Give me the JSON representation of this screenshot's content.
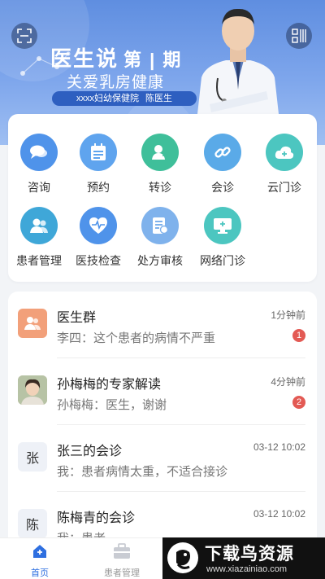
{
  "banner": {
    "title": "医生说",
    "issue": "第 | 期",
    "subtitle": "关爱乳房健康",
    "hospital": "xxxx妇幼保健院",
    "doctor": "陈医生"
  },
  "services": [
    {
      "label": "咨询",
      "icon": "chat-icon",
      "color": "#4f93ea"
    },
    {
      "label": "预约",
      "icon": "calendar-icon",
      "color": "#5fa4ee"
    },
    {
      "label": "转诊",
      "icon": "transfer-icon",
      "color": "#3fbf9a"
    },
    {
      "label": "会诊",
      "icon": "link-icon",
      "color": "#5aaae8"
    },
    {
      "label": "云门诊",
      "icon": "cloud-icon",
      "color": "#4cc6c0"
    },
    {
      "label": "患者管理",
      "icon": "patients-icon",
      "color": "#3fa7d8"
    },
    {
      "label": "医技检查",
      "icon": "heart-pulse-icon",
      "color": "#4f93ea"
    },
    {
      "label": "处方审核",
      "icon": "prescription-icon",
      "color": "#7fb2ec"
    },
    {
      "label": "网络门诊",
      "icon": "monitor-icon",
      "color": "#4cc6c0"
    }
  ],
  "messages": [
    {
      "title": "医生群",
      "preview": "李四：这个患者的病情不严重",
      "time": "1分钟前",
      "badge": "1",
      "avatar_text": ""
    },
    {
      "title": "孙梅梅的专家解读",
      "preview": "孙梅梅：医生，谢谢",
      "time": "4分钟前",
      "badge": "2",
      "avatar_text": ""
    },
    {
      "title": "张三的会诊",
      "preview": "我：患者病情太重，不适合接诊",
      "time": "03-12 10:02",
      "badge": "",
      "avatar_text": "张"
    },
    {
      "title": "陈梅青的会诊",
      "preview": "我：患者",
      "time": "03-12 10:02",
      "badge": "",
      "avatar_text": "陈"
    }
  ],
  "tabs": [
    {
      "label": "首页",
      "icon": "home-icon",
      "active": true
    },
    {
      "label": "患者管理",
      "icon": "briefcase-icon",
      "active": false
    }
  ],
  "watermark": {
    "text": "下载鸟资源",
    "url": "www.xiazainiao.com"
  },
  "colors": {
    "accent": "#2e6fe0",
    "badge": "#e35a54",
    "group_avatar": "#f2a07a"
  }
}
